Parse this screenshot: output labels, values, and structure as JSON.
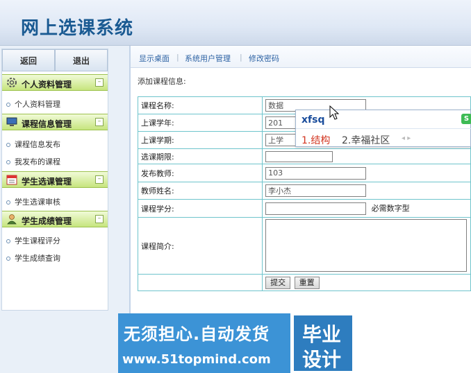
{
  "header": {
    "title": "网上选课系统"
  },
  "sidebar": {
    "top_buttons": [
      "返回",
      "退出"
    ],
    "sections": [
      {
        "title": "个人资料管理",
        "icon": "gear-icon",
        "items": [
          "个人资料管理"
        ]
      },
      {
        "title": "课程信息管理",
        "icon": "monitor-icon",
        "items": [
          "课程信息发布",
          "我发布的课程"
        ]
      },
      {
        "title": "学生选课管理",
        "icon": "calendar-icon",
        "items": [
          "学生选课审核"
        ]
      },
      {
        "title": "学生成绩管理",
        "icon": "user-icon",
        "items": [
          "学生课程评分",
          "学生成绩查询"
        ]
      }
    ],
    "toggle_symbol": "–"
  },
  "topnav": {
    "links": [
      "显示桌面",
      "系统用户管理",
      "修改密码"
    ]
  },
  "form": {
    "heading": "添加课程信息:",
    "rows": [
      {
        "label": "课程名称:",
        "value": "数据"
      },
      {
        "label": "上课学年:",
        "value": "201"
      },
      {
        "label": "上课学期:",
        "value": "上学"
      },
      {
        "label": "选课期限:",
        "value": ""
      },
      {
        "label": "发布教师:",
        "value": "103"
      },
      {
        "label": "教师姓名:",
        "value": "李小杰"
      },
      {
        "label": "课程学分:",
        "value": "",
        "hint": "必需数字型"
      },
      {
        "label": "课程简介:",
        "value": ""
      }
    ],
    "submit_label": "提交",
    "reset_label": "重置"
  },
  "ime": {
    "input": "xfsq",
    "candidates": [
      "1.结构",
      "2.幸福社区"
    ],
    "arrows": "◂ ▸",
    "logo": "S"
  },
  "watermark": {
    "line1": "无须担心.自动发货",
    "line2": "www.51topmind.com",
    "right1": "毕业",
    "right2": "设计"
  }
}
